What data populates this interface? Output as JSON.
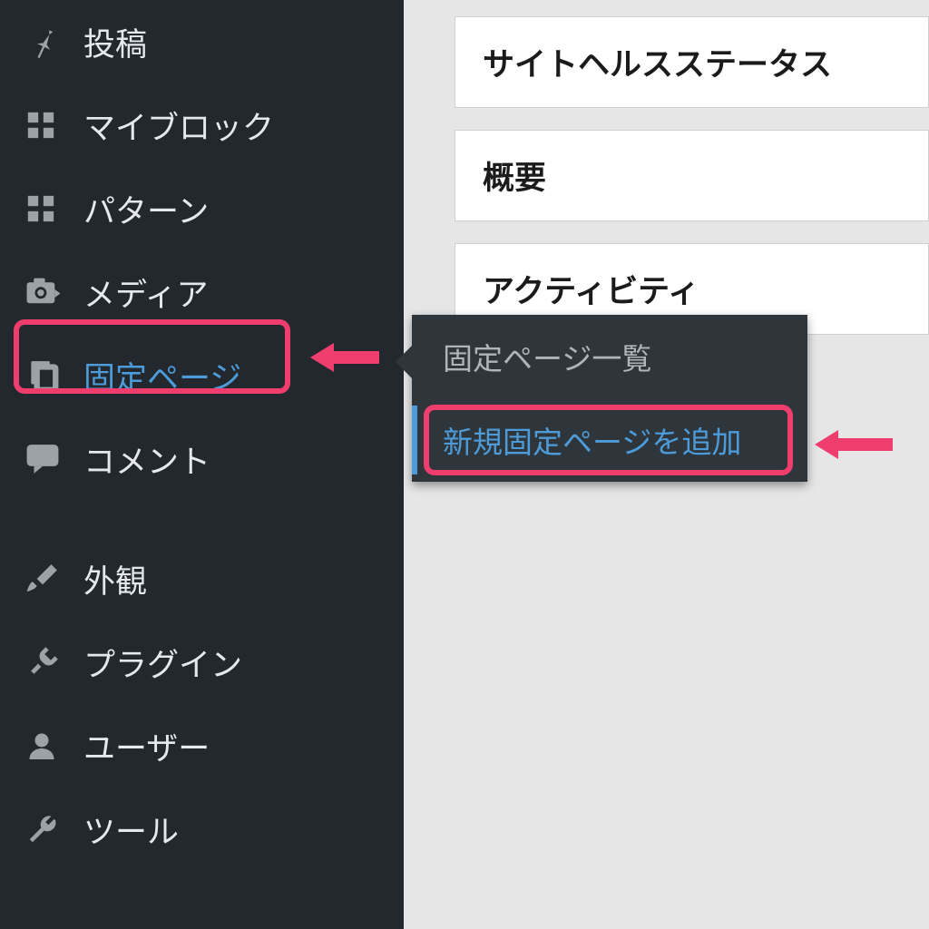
{
  "sidebar": {
    "items": [
      {
        "label": "投稿",
        "icon": "pin-icon"
      },
      {
        "label": "マイブロック",
        "icon": "grid-icon"
      },
      {
        "label": "パターン",
        "icon": "grid-icon"
      },
      {
        "label": "メディア",
        "icon": "camera-icon"
      },
      {
        "label": "固定ページ",
        "icon": "pages-icon",
        "active": true
      },
      {
        "label": "コメント",
        "icon": "comment-icon"
      },
      {
        "label": "外観",
        "icon": "brush-icon"
      },
      {
        "label": "プラグイン",
        "icon": "plug-icon"
      },
      {
        "label": "ユーザー",
        "icon": "user-icon"
      },
      {
        "label": "ツール",
        "icon": "wrench-icon"
      }
    ]
  },
  "panels": {
    "site_health": "サイトヘルスステータス",
    "overview": "概要",
    "activity": "アクティビティ"
  },
  "flyout": {
    "list_label": "固定ページ一覧",
    "add_new_label": "新規固定ページを追加"
  },
  "colors": {
    "accent": "#4d9bd8",
    "annotation": "#ef3e6d",
    "sidebar_bg": "#22282d",
    "flyout_bg": "#2e363c"
  }
}
